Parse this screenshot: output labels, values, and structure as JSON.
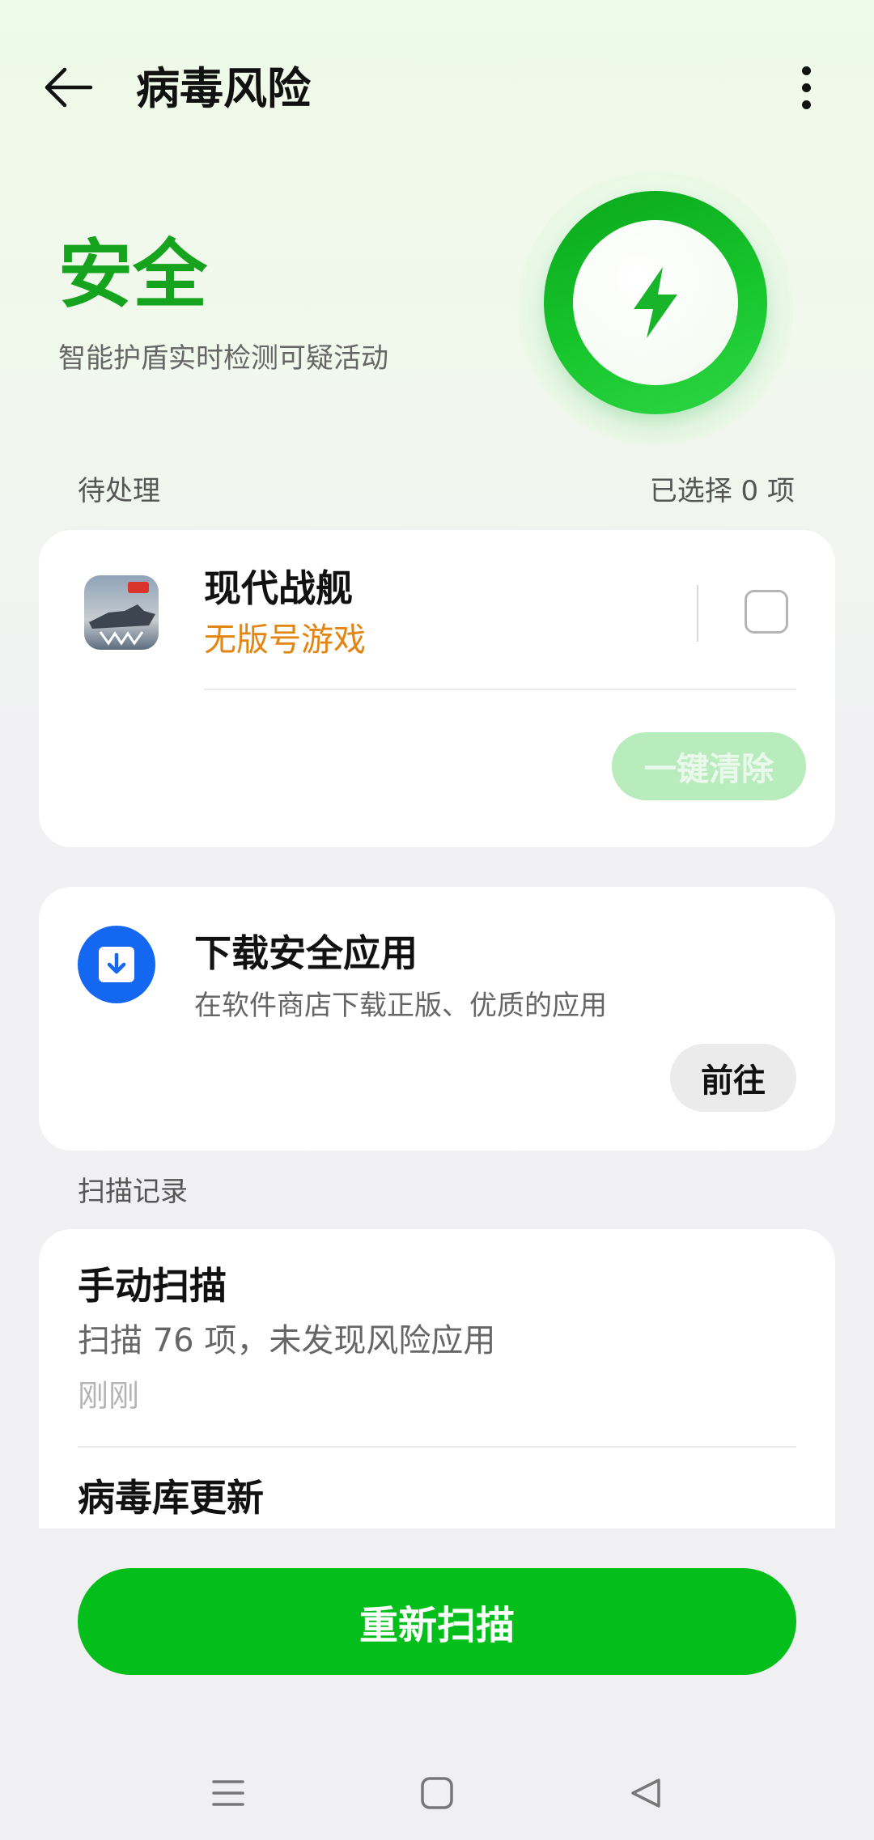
{
  "header": {
    "title": "病毒风险"
  },
  "status": {
    "title": "安全",
    "subtitle": "智能护盾实时检测可疑活动"
  },
  "pending": {
    "label": "待处理",
    "selected": "已选择 0 项",
    "app": {
      "name": "现代战舰",
      "risk": "无版号游戏"
    },
    "clear_label": "一键清除"
  },
  "download": {
    "title": "下载安全应用",
    "subtitle": "在软件商店下载正版、优质的应用",
    "button": "前往"
  },
  "records": {
    "label": "扫描记录",
    "items": [
      {
        "title": "手动扫描",
        "desc": "扫描 76 项，未发现风险应用",
        "time": "刚刚"
      },
      {
        "title": "病毒库更新"
      }
    ]
  },
  "rescan_label": "重新扫描",
  "colors": {
    "accent": "#04be1c",
    "risk": "#e38512",
    "info": "#1467f0"
  }
}
